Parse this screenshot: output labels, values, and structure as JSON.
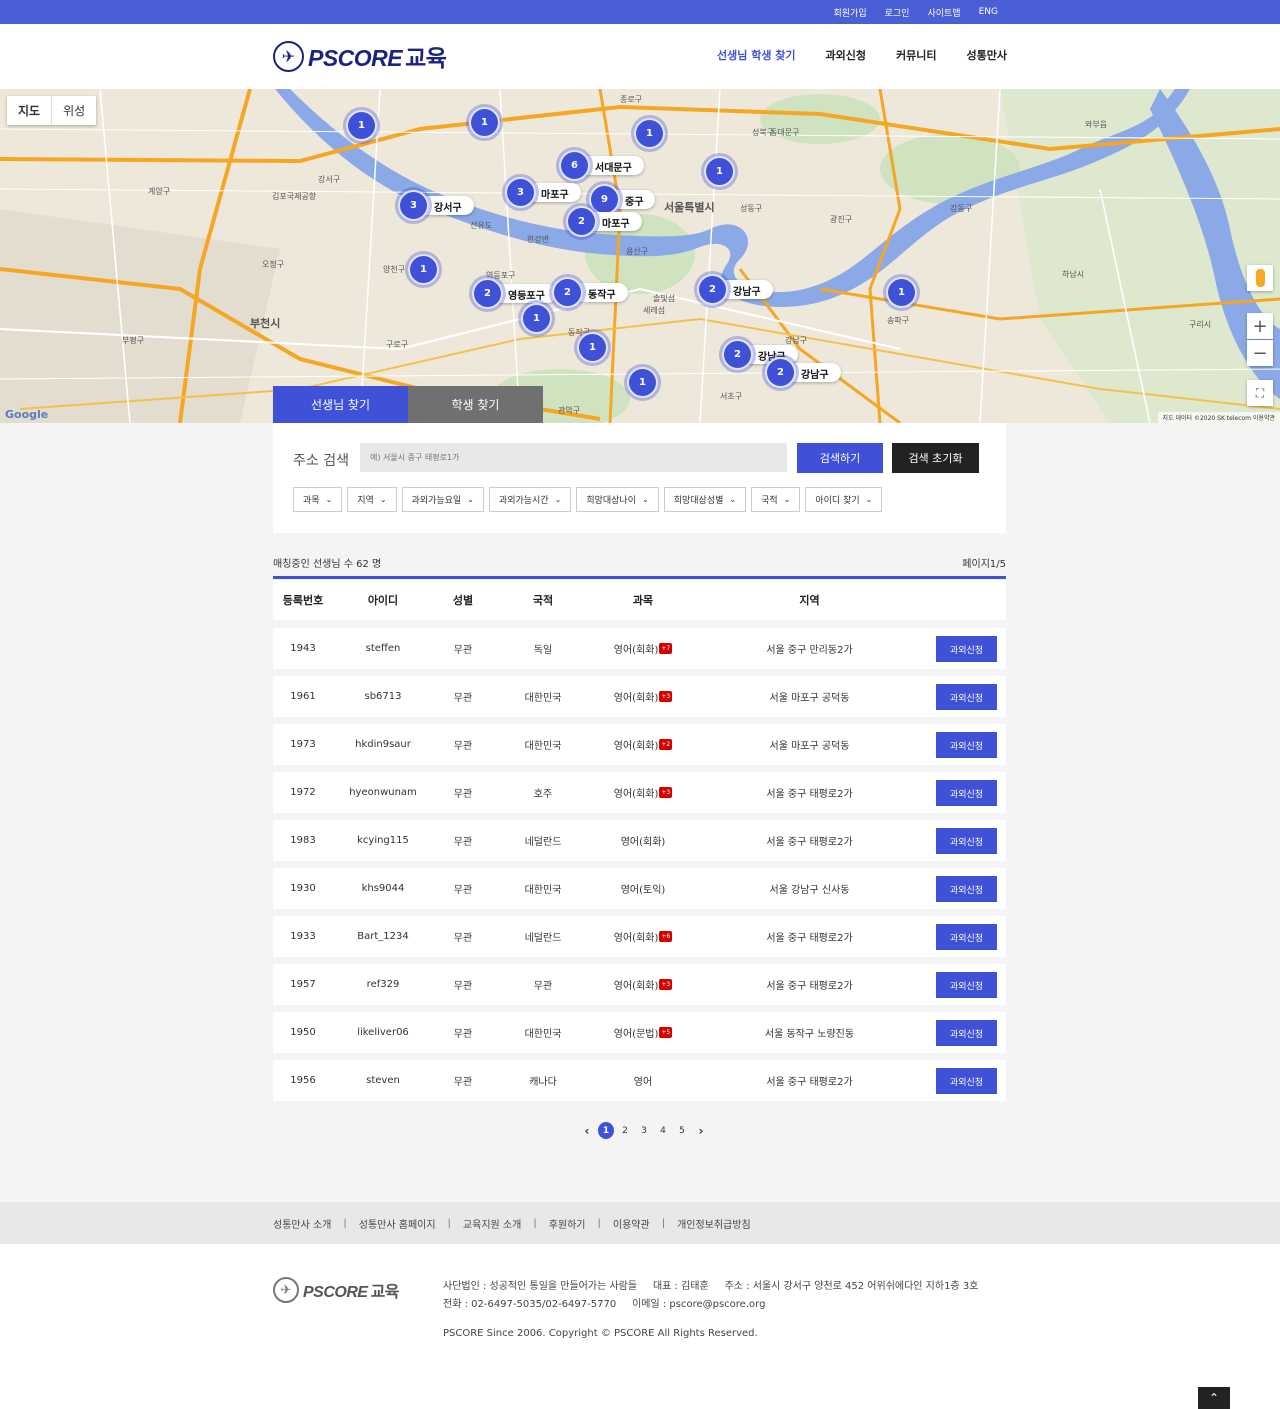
{
  "topbar": {
    "links": [
      "회원가입",
      "로그인",
      "사이트맵",
      "ENG"
    ]
  },
  "logo": {
    "text": "PSCORE",
    "ko": "교육"
  },
  "nav": {
    "items": [
      "선생님 학생 찾기",
      "과외신청",
      "커뮤니티",
      "성통만사"
    ],
    "active": 0
  },
  "map": {
    "type_buttons": [
      "지도",
      "위성"
    ],
    "clusters": [
      {
        "count": "1",
        "label": ""
      },
      {
        "count": "1",
        "label": ""
      },
      {
        "count": "1",
        "label": ""
      },
      {
        "count": "6",
        "label": "서대문구"
      },
      {
        "count": "1",
        "label": ""
      },
      {
        "count": "3",
        "label": "마포구"
      },
      {
        "count": "9",
        "label": "중구"
      },
      {
        "count": "3",
        "label": "강서구"
      },
      {
        "count": "2",
        "label": "마포구"
      },
      {
        "count": "1",
        "label": ""
      },
      {
        "count": "2",
        "label": "영등포구"
      },
      {
        "count": "2",
        "label": "동작구"
      },
      {
        "count": "2",
        "label": "강남구"
      },
      {
        "count": "1",
        "label": ""
      },
      {
        "count": "1",
        "label": ""
      },
      {
        "count": "1",
        "label": ""
      },
      {
        "count": "2",
        "label": "강남구"
      },
      {
        "count": "2",
        "label": "강남구"
      },
      {
        "count": "1",
        "label": ""
      }
    ],
    "place_labels": [
      "강서구",
      "김포국제공항",
      "계양구",
      "오정구",
      "부천시",
      "부평구",
      "양천구",
      "구로구",
      "영등포구",
      "동작구",
      "관악구",
      "서초구",
      "강남구",
      "송파구",
      "하남시",
      "광진구",
      "성동구",
      "용산구",
      "서울특별시",
      "종로구",
      "성북구",
      "동대문구",
      "강동구",
      "구리시",
      "와부읍",
      "선유도",
      "한강변",
      "솔빛섬",
      "세레섬"
    ],
    "google": "Google",
    "attribution": "지도 데이터 ©2020 SK telecom   이용약관",
    "tabs": [
      "선생님 찾기",
      "학생 찾기"
    ]
  },
  "search": {
    "label": "주소 검색",
    "placeholder": "예) 서울시 중구 태평로1가",
    "search_button": "검색하기",
    "reset_button": "검색 초기화",
    "filters": [
      "과목",
      "지역",
      "과외가능요일",
      "과외가능시간",
      "희망대상나이",
      "희망대상성별",
      "국적",
      "아이디 찾기"
    ]
  },
  "summary": {
    "count_text": "매칭중인 선생님 수 62 명",
    "page_text": "페이지1/5"
  },
  "table": {
    "headers": [
      "등록번호",
      "아이디",
      "성별",
      "국적",
      "과목",
      "지역"
    ],
    "apply_label": "과외신청",
    "rows": [
      {
        "id": "1943",
        "user": "steffen",
        "gender": "무관",
        "nation": "독일",
        "subject": "영어(회화)",
        "badge": "+7",
        "region": "서울 중구 만리동2가"
      },
      {
        "id": "1961",
        "user": "sb6713",
        "gender": "무관",
        "nation": "대한민국",
        "subject": "영어(회화)",
        "badge": "+3",
        "region": "서울 마포구 공덕동"
      },
      {
        "id": "1973",
        "user": "hkdin9saur",
        "gender": "무관",
        "nation": "대한민국",
        "subject": "영어(회화)",
        "badge": "+2",
        "region": "서울 마포구 공덕동"
      },
      {
        "id": "1972",
        "user": "hyeonwunam",
        "gender": "무관",
        "nation": "호주",
        "subject": "영어(회화)",
        "badge": "+3",
        "region": "서울 중구 태평로2가"
      },
      {
        "id": "1983",
        "user": "kcying115",
        "gender": "무관",
        "nation": "네덜란드",
        "subject": "영어(회화)",
        "badge": "",
        "region": "서울 중구 태평로2가"
      },
      {
        "id": "1930",
        "user": "khs9044",
        "gender": "무관",
        "nation": "대한민국",
        "subject": "영어(토익)",
        "badge": "",
        "region": "서울 강남구 신사동"
      },
      {
        "id": "1933",
        "user": "Bart_1234",
        "gender": "무관",
        "nation": "네덜란드",
        "subject": "영어(회화)",
        "badge": "+6",
        "region": "서울 중구 태평로2가"
      },
      {
        "id": "1957",
        "user": "ref329",
        "gender": "무관",
        "nation": "무관",
        "subject": "영어(회화)",
        "badge": "+3",
        "region": "서울 중구 태평로2가"
      },
      {
        "id": "1950",
        "user": "likeliver06",
        "gender": "무관",
        "nation": "대한민국",
        "subject": "영어(문법)",
        "badge": "+5",
        "region": "서울 동작구 노량진동"
      },
      {
        "id": "1956",
        "user": "steven",
        "gender": "무관",
        "nation": "캐나다",
        "subject": "영어",
        "badge": "",
        "region": "서울 중구 태평로2가"
      }
    ]
  },
  "pager": {
    "pages": [
      "1",
      "2",
      "3",
      "4",
      "5"
    ],
    "current": "1",
    "prev": "‹",
    "next": "›"
  },
  "footer": {
    "links": [
      "성통만사 소개",
      "성통만사 홈페이지",
      "교육지원 소개",
      "후원하기",
      "이용약관",
      "개인정보취급방침"
    ],
    "logo_text": "PSCORE",
    "logo_ko": "교육",
    "line1": "사단법인 : 성공적인 통일을 만들어가는 사람들     대표 : 김태훈     주소 : 서울시 강서구 양천로 452 어위쉬에다인 지하1층 3호",
    "line2": "전화 : 02-6497-5035/02-6497-5770     이메일 : pscore@pscore.org",
    "copyright": "PSCORE Since 2006. Copyright © PSCORE All Rights Reserved."
  },
  "colors": {
    "accent": "#3f51d6",
    "topbar": "#4a5fd6",
    "badge": "#d50000",
    "dark": "#222222"
  },
  "icons": {
    "zoom_in": "plus-icon",
    "zoom_out": "minus-icon",
    "fullscreen": "fullscreen-icon",
    "pegman": "pegman-icon",
    "to_top": "chevron-up-icon"
  }
}
